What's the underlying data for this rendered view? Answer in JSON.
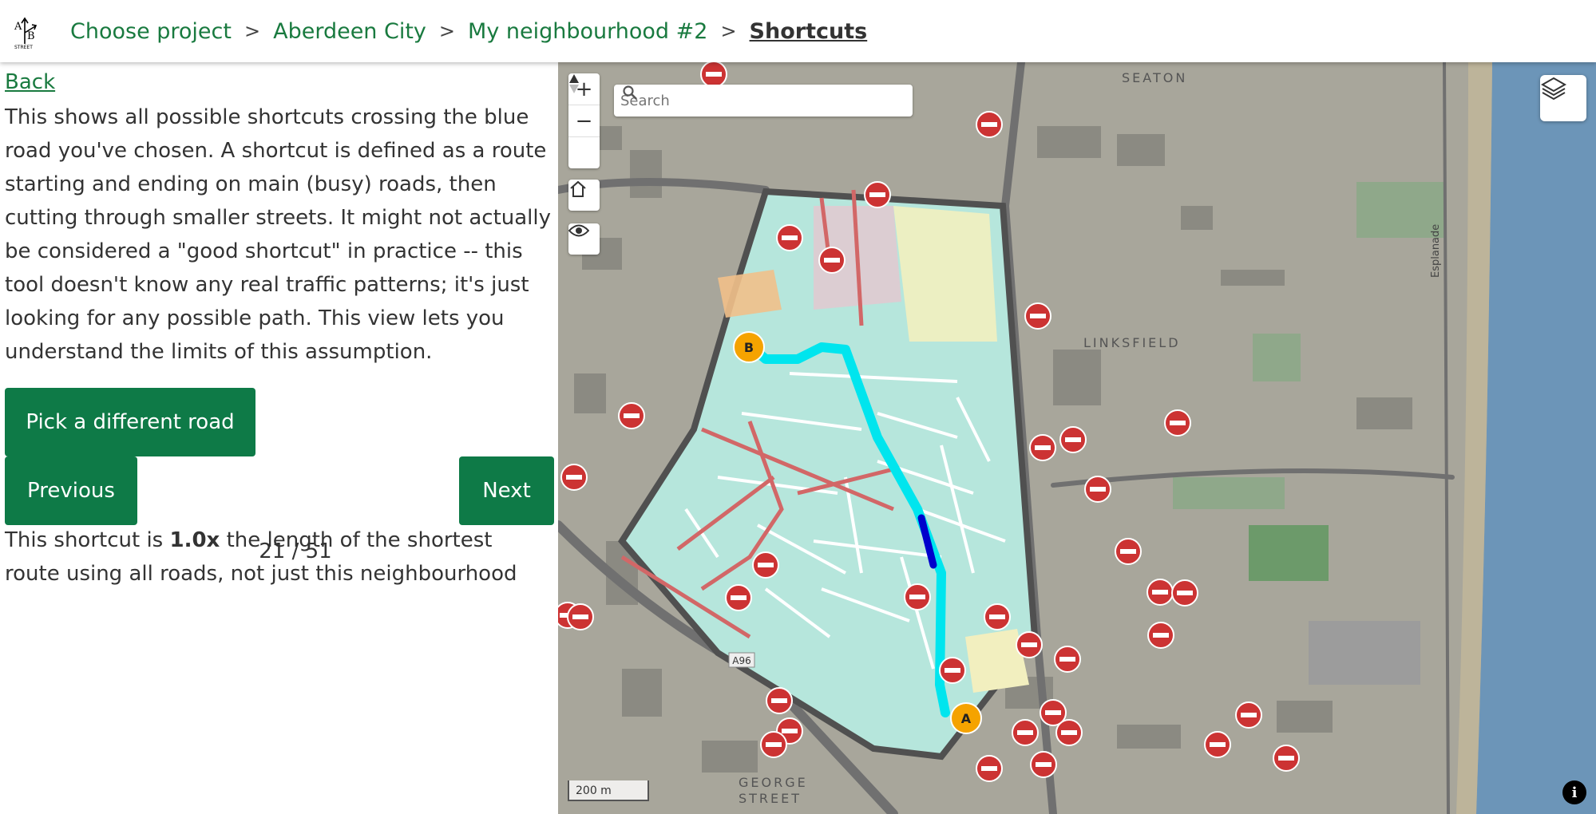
{
  "header": {
    "logo_alt": "A/B Street",
    "logo_text": "STREET",
    "breadcrumbs": [
      "Choose project",
      "Aberdeen City",
      "My neighbourhood #2"
    ],
    "current": "Shortcuts",
    "separator": ">"
  },
  "panel": {
    "back_label": "Back",
    "description": "This shows all possible shortcuts crossing the blue road you've chosen. A shortcut is defined as a route starting and ending on main (busy) roads, then cutting through smaller streets. It might not actually be considered a \"good shortcut\" in practice -- this tool doesn't know any real traffic patterns; it's just looking for any possible path. This view lets you understand the limits of this assumption.",
    "pick_button": "Pick a different road",
    "previous_button": "Previous",
    "next_button": "Next",
    "counter": "21 / 51",
    "ratio_prefix": "This shortcut is ",
    "ratio_value": "1.0x",
    "ratio_suffix": " the length of the shortest route using all roads, not just this neighbourhood"
  },
  "map": {
    "search_placeholder": "Search",
    "zoom_in": "+",
    "zoom_out": "−",
    "scale_label": "200 m",
    "info_label": "i",
    "marker_a": "A",
    "marker_b": "B",
    "labels": {
      "seaton": "SEATON",
      "linksfield": "LINKSFIELD",
      "esplanade": "Esplanade",
      "george": "GEORGE",
      "street": "STREET",
      "a96": "A96"
    },
    "colors": {
      "accent": "#0e7a47",
      "link": "#197a3f",
      "shortcut": "#00e5ee",
      "selected_road": "#0000cc",
      "marker": "#f5a300",
      "neighbourhood_fill": "#b6e6dc",
      "water": "#6c95b8"
    }
  }
}
